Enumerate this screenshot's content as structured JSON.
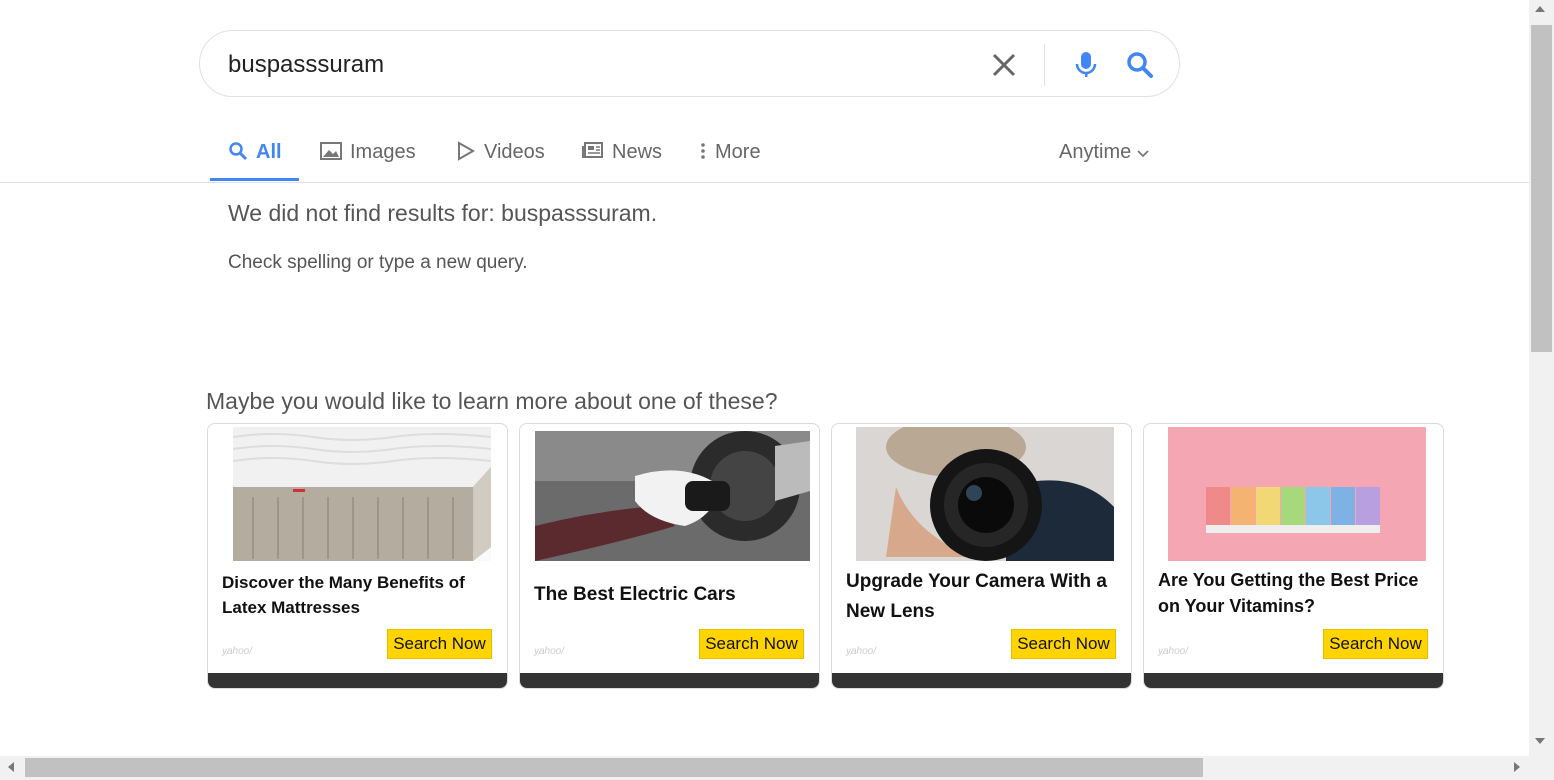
{
  "search": {
    "query": "buspasssuram"
  },
  "tabs": [
    {
      "label": "All",
      "icon": "search-icon"
    },
    {
      "label": "Images",
      "icon": "image-icon"
    },
    {
      "label": "Videos",
      "icon": "play-icon"
    },
    {
      "label": "News",
      "icon": "news-icon"
    },
    {
      "label": "More",
      "icon": "kebab-icon"
    }
  ],
  "filter": {
    "anytime": "Anytime"
  },
  "message": {
    "no_results": "We did not find results for: buspasssuram.",
    "hint": "Check spelling or type a new query."
  },
  "suggestions": {
    "heading": "Maybe you would like to learn more about one of these?",
    "cards": [
      {
        "title": "Discover the Many Benefits of Latex Mattresses",
        "cta": "Search Now",
        "brand": "yahoo/"
      },
      {
        "title": "The Best Electric Cars",
        "cta": "Search Now",
        "brand": "yahoo/"
      },
      {
        "title": "Upgrade Your Camera With a New Lens",
        "cta": "Search Now",
        "brand": "yahoo/"
      },
      {
        "title": "Are You Getting the Best Price on Your Vitamins?",
        "cta": "Search Now",
        "brand": "yahoo/"
      }
    ]
  },
  "colors": {
    "accent": "#4285f4",
    "cta": "#ffd400"
  }
}
